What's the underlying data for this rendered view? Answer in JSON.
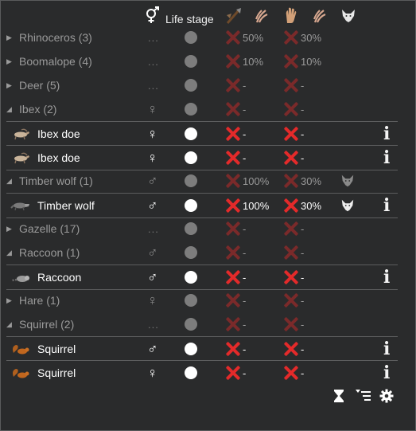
{
  "header": {
    "life_stage": "Life stage",
    "gender_icon": "gender-symbol-icon",
    "col_icons": [
      "hunting-weapon-icon",
      "claw-attack-icon",
      "hand-tame-icon",
      "claw-manhunter-icon",
      "wolf-predator-icon"
    ]
  },
  "rows": [
    {
      "type": "group",
      "expanded": false,
      "name": "Rhinoceros (3)",
      "gender": "...",
      "pct1": "50%",
      "pct2": "30%",
      "predator": false
    },
    {
      "type": "group",
      "expanded": false,
      "name": "Boomalope (4)",
      "gender": "...",
      "pct1": "10%",
      "pct2": "10%",
      "predator": false
    },
    {
      "type": "group",
      "expanded": false,
      "name": "Deer (5)",
      "gender": "...",
      "pct1": "-",
      "pct2": "-",
      "predator": false
    },
    {
      "type": "group",
      "expanded": true,
      "name": "Ibex (2)",
      "gender": "♀",
      "pct1": "-",
      "pct2": "-",
      "predator": false
    },
    {
      "type": "animal",
      "thumb": "ibex-icon",
      "name": "Ibex doe",
      "gender": "♀",
      "pct1": "-",
      "pct2": "-",
      "predator": false,
      "info": "i"
    },
    {
      "type": "animal",
      "thumb": "ibex-icon",
      "name": "Ibex doe",
      "gender": "♀",
      "pct1": "-",
      "pct2": "-",
      "predator": false,
      "info": "i",
      "last": true
    },
    {
      "type": "group",
      "expanded": true,
      "name": "Timber wolf (1)",
      "gender": "♂",
      "pct1": "100%",
      "pct2": "30%",
      "predator": true
    },
    {
      "type": "animal",
      "thumb": "wolf-icon",
      "name": "Timber wolf",
      "gender": "♂",
      "pct1": "100%",
      "pct2": "30%",
      "predator": true,
      "info": "i",
      "last": true
    },
    {
      "type": "group",
      "expanded": false,
      "name": "Gazelle (17)",
      "gender": "...",
      "pct1": "-",
      "pct2": "-",
      "predator": false
    },
    {
      "type": "group",
      "expanded": true,
      "name": "Raccoon (1)",
      "gender": "♂",
      "pct1": "-",
      "pct2": "-",
      "predator": false
    },
    {
      "type": "animal",
      "thumb": "raccoon-icon",
      "name": "Raccoon",
      "gender": "♂",
      "pct1": "-",
      "pct2": "-",
      "predator": false,
      "info": "i",
      "last": true
    },
    {
      "type": "group",
      "expanded": false,
      "name": "Hare (1)",
      "gender": "♀",
      "pct1": "-",
      "pct2": "-",
      "predator": false
    },
    {
      "type": "group",
      "expanded": true,
      "name": "Squirrel (2)",
      "gender": "...",
      "pct1": "-",
      "pct2": "-",
      "predator": false
    },
    {
      "type": "animal",
      "thumb": "squirrel-icon",
      "name": "Squirrel",
      "gender": "♂",
      "pct1": "-",
      "pct2": "-",
      "predator": false,
      "info": "i"
    },
    {
      "type": "animal",
      "thumb": "squirrel-icon",
      "name": "Squirrel",
      "gender": "♀",
      "pct1": "-",
      "pct2": "-",
      "predator": false,
      "info": "i"
    }
  ],
  "footer": {
    "icons": [
      "hourglass-icon",
      "sort-list-icon",
      "gear-icon"
    ]
  }
}
